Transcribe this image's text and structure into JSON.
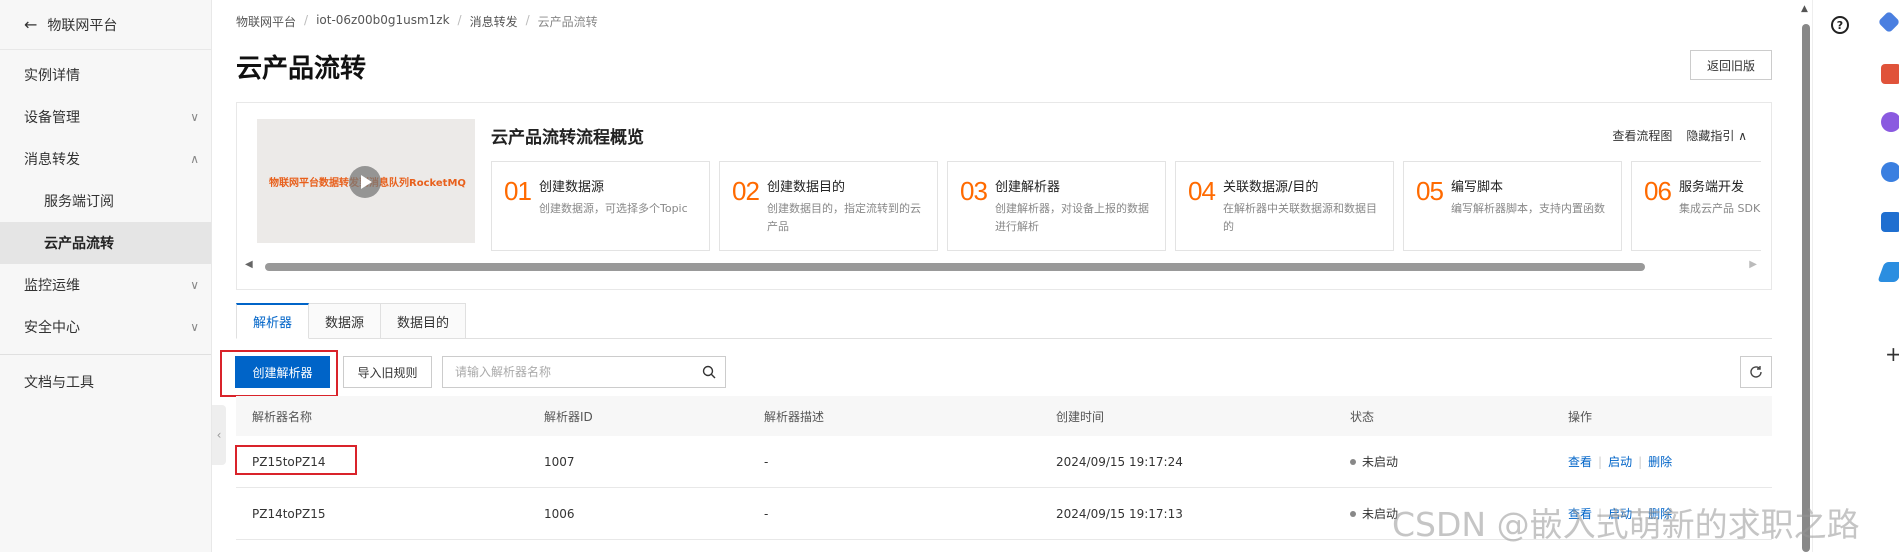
{
  "sidebar": {
    "back_label": "物联网平台",
    "items": [
      {
        "label": "实例详情",
        "chevron": ""
      },
      {
        "label": "设备管理",
        "chevron": "∨"
      },
      {
        "label": "消息转发",
        "chevron": "∧"
      },
      {
        "label": "服务端订阅",
        "chevron": ""
      },
      {
        "label": "云产品流转",
        "chevron": ""
      },
      {
        "label": "监控运维",
        "chevron": "∨"
      },
      {
        "label": "安全中心",
        "chevron": "∨"
      },
      {
        "label": "文档与工具",
        "chevron": ""
      }
    ],
    "active_item": "云产品流转"
  },
  "breadcrumb": [
    "物联网平台",
    "iot-06z00b0g1usm1zk",
    "消息转发",
    "云产品流转"
  ],
  "page_title": "云产品流转",
  "back_old_label": "返回旧版",
  "overview": {
    "thumb_text": "物联网平台数据转发到消息队列RocketMQ",
    "title": "云产品流转流程概览",
    "link_flow": "查看流程图",
    "link_hide": "隐藏指引 ∧",
    "steps": [
      {
        "num": "01",
        "title": "创建数据源",
        "desc": "创建数据源，可选择多个Topic"
      },
      {
        "num": "02",
        "title": "创建数据目的",
        "desc": "创建数据目的，指定流转到的云产品"
      },
      {
        "num": "03",
        "title": "创建解析器",
        "desc": "创建解析器，对设备上报的数据进行解析"
      },
      {
        "num": "04",
        "title": "关联数据源/目的",
        "desc": "在解析器中关联数据源和数据目的"
      },
      {
        "num": "05",
        "title": "编写脚本",
        "desc": "编写解析器脚本，支持内置函数"
      },
      {
        "num": "06",
        "title": "服务端开发",
        "desc": "集成云产品 SDK 程序"
      }
    ]
  },
  "tabs": [
    "解析器",
    "数据源",
    "数据目的"
  ],
  "toolbar": {
    "create_label": "创建解析器",
    "import_label": "导入旧规则",
    "search_placeholder": "请输入解析器名称"
  },
  "table": {
    "headers": [
      "解析器名称",
      "解析器ID",
      "解析器描述",
      "创建时间",
      "状态",
      "操作"
    ],
    "rows": [
      {
        "name": "PZ15toPZ14",
        "id": "1007",
        "desc": "-",
        "created": "2024/09/15 19:17:24",
        "status": "未启动",
        "ops": [
          "查看",
          "启动",
          "删除"
        ]
      },
      {
        "name": "PZ14toPZ15",
        "id": "1006",
        "desc": "-",
        "created": "2024/09/15 19:17:13",
        "status": "未启动",
        "ops": [
          "查看",
          "启动",
          "删除"
        ]
      }
    ]
  },
  "watermark": "CSDN @嵌入式萌新的求职之路",
  "colors": {
    "primary": "#0064c8",
    "accent": "#ff6a00",
    "highlight": "#d9232a"
  }
}
